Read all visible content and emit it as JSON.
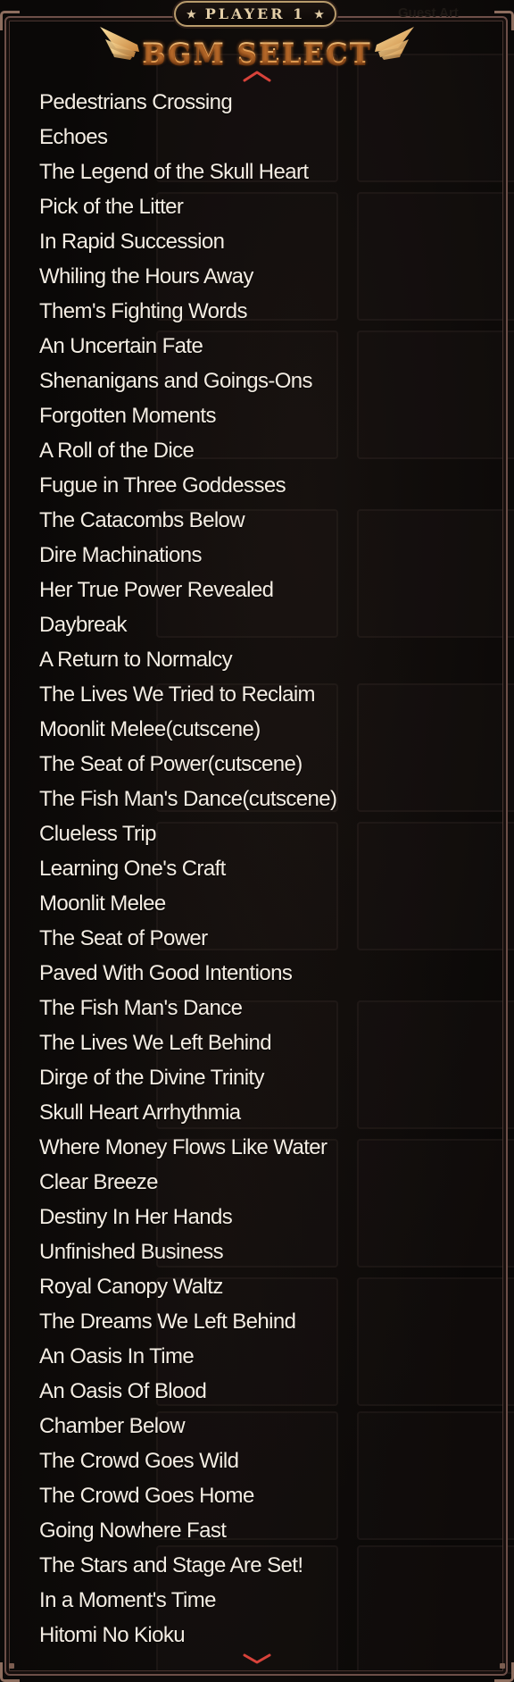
{
  "header": {
    "player_label": "PLAYER 1",
    "star_left": "★",
    "star_right": "★",
    "ghost_label": "Guest Art",
    "title": "BGM SELECT"
  },
  "icons": {
    "scroll_up": "chevron-up-icon",
    "scroll_down": "chevron-down-icon",
    "wing_left": "wing-icon",
    "wing_right": "wing-icon"
  },
  "colors": {
    "title_top": "#fbe3a6",
    "title_bottom": "#e79a48",
    "list_text": "#f4ede3",
    "frame": "#6d4f48",
    "arrow": "#d8423a"
  },
  "songs": [
    "Pedestrians Crossing",
    "Echoes",
    "The Legend of the Skull Heart",
    "Pick of the Litter",
    "In Rapid Succession",
    "Whiling the Hours Away",
    "Them's Fighting Words",
    "An Uncertain Fate",
    "Shenanigans and Goings-Ons",
    "Forgotten Moments",
    "A Roll of the Dice",
    "Fugue in Three Goddesses",
    "The Catacombs Below",
    "Dire Machinations",
    "Her True Power Revealed",
    "Daybreak",
    "A Return to Normalcy",
    "The Lives We Tried to Reclaim",
    "Moonlit Melee(cutscene)",
    "The Seat of Power(cutscene)",
    "The Fish Man's Dance(cutscene)",
    "Clueless Trip",
    "Learning One's Craft",
    "Moonlit Melee",
    "The Seat of Power",
    "Paved With Good Intentions",
    "The Fish Man's Dance",
    "The Lives We Left Behind",
    "Dirge of the Divine Trinity",
    "Skull Heart Arrhythmia",
    "Where Money Flows Like Water",
    "Clear Breeze",
    "Destiny In Her Hands",
    "Unfinished Business",
    "Royal Canopy Waltz",
    "The Dreams We Left Behind",
    "An Oasis In Time",
    "An Oasis Of Blood",
    "Chamber Below",
    "The Crowd Goes Wild",
    "The Crowd Goes Home",
    "Going Nowhere Fast",
    "The Stars and Stage Are Set!",
    "In a Moment's Time",
    "Hitomi No Kioku"
  ]
}
